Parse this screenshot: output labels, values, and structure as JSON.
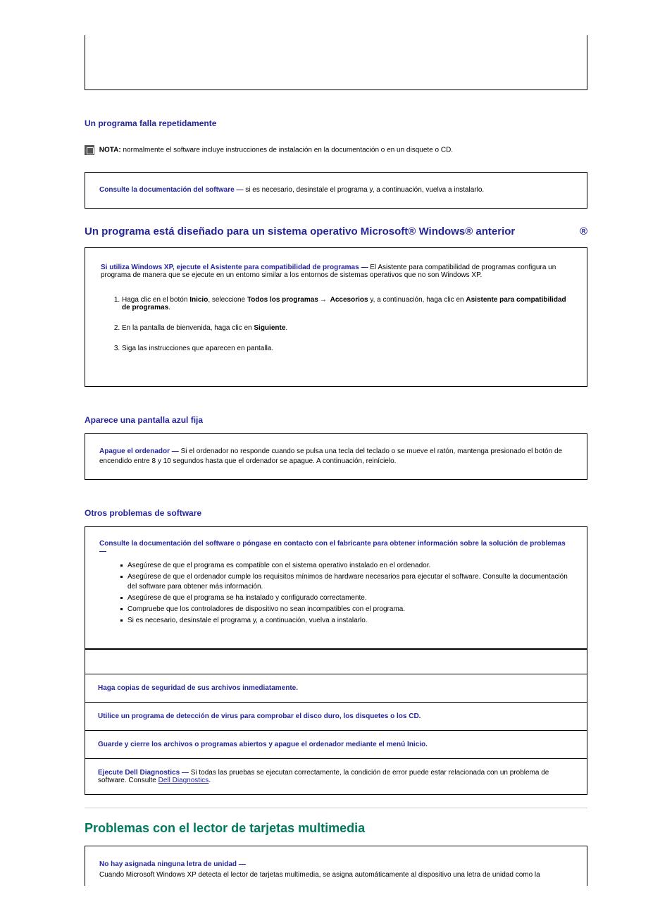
{
  "topEmpty": "",
  "sectionProgramaFalla": "Un programa falla repetidamente",
  "noteLabel": "NOTA:",
  "noteText": "normalmente el software incluye instrucciones de instalación en la documentación o en un disquete o CD.",
  "box1Lead": "Consulte la documentación del software —",
  "box1Text": "si es necesario, desinstale el programa y, a continuación, vuelva a instalarlo.",
  "bigHead": "Un programa está diseñado para un sistema operativo Microsoft® Windows® anterior",
  "rightReg": "®",
  "olBox": {
    "lead": "Si utiliza Windows XP, ejecute el Asistente para compatibilidad de programas —",
    "leadTail": "El Asistente para compatibilidad de programas configura un programa de manera que se ejecute en un entorno similar a los entornos de sistemas operativos que no son Windows XP.",
    "li1a": "Haga clic en el botón",
    "li1b": "Inicio",
    "li1c": ", seleccione",
    "li1d": "Todos los programas",
    "li1arrow": "→",
    "li1e": "Accesorios",
    "li1f": "y, a continuación, haga clic en",
    "li1g": "Asistente para compatibilidad de programas",
    "li1h": ".",
    "li2a": "En la pantalla de bienvenida, haga clic en",
    "li2b": "Siguiente",
    "li2c": ".",
    "li3": "Siga las instrucciones que aparecen en pantalla."
  },
  "sectionAzul": "Aparece una pantalla azul fija",
  "boxAzulLead": "Apague el ordenador —",
  "boxAzulText": "Si el ordenador no responde cuando se pulsa una tecla del teclado o se mueve el ratón, mantenga presionado el botón de encendido entre 8 y 10 segundos hasta que el ordenador se apague. A continuación, reinícielo.",
  "sectionOtros": "Otros problemas de software",
  "multiLead": "Consulte la documentación del software o póngase en contacto con el fabricante para obtener información sobre la solución de problemas —",
  "multi": {
    "a": "Asegúrese de que el programa es compatible con el sistema operativo instalado en el ordenador.",
    "b": "Asegúrese de que el ordenador cumple los requisitos mínimos de hardware necesarios para ejecutar el software. Consulte la documentación del software para obtener más información.",
    "c": "Asegúrese de que el programa se ha instalado y configurado correctamente.",
    "d": "Compruebe que los controladores de dispositivo no sean incompatibles con el programa.",
    "e": "Si es necesario, desinstale el programa y, a continuación, vuelva a instalarlo."
  },
  "stack": {
    "r1": "Haga copias de seguridad de sus archivos inmediatamente.",
    "r2a": "Utilice un programa de detección de virus para comprobar el disco duro, los disquetes o los CD.",
    "r3a": "Guarde y cierre los archivos o programas abiertos y apague el ordenador mediante el menú",
    "r3b": "Inicio.",
    "r4a": "Ejecute Dell Diagnostics —",
    "r4b": "Si todas las pruebas se ejecutan correctamente, la condición de error puede estar relacionada con un problema de software. Consulte",
    "r4link": "Dell Diagnostics",
    "r4c": "."
  },
  "h2green": "Problemas con el lector de tarjetas multimedia",
  "boxOpen": {
    "lead": "No hay asignada ninguna letra de unidad",
    "dash": "—",
    "text": "Cuando Microsoft Windows XP detecta el lector de tarjetas multimedia, se asigna automáticamente al dispositivo una letra de unidad como la"
  }
}
